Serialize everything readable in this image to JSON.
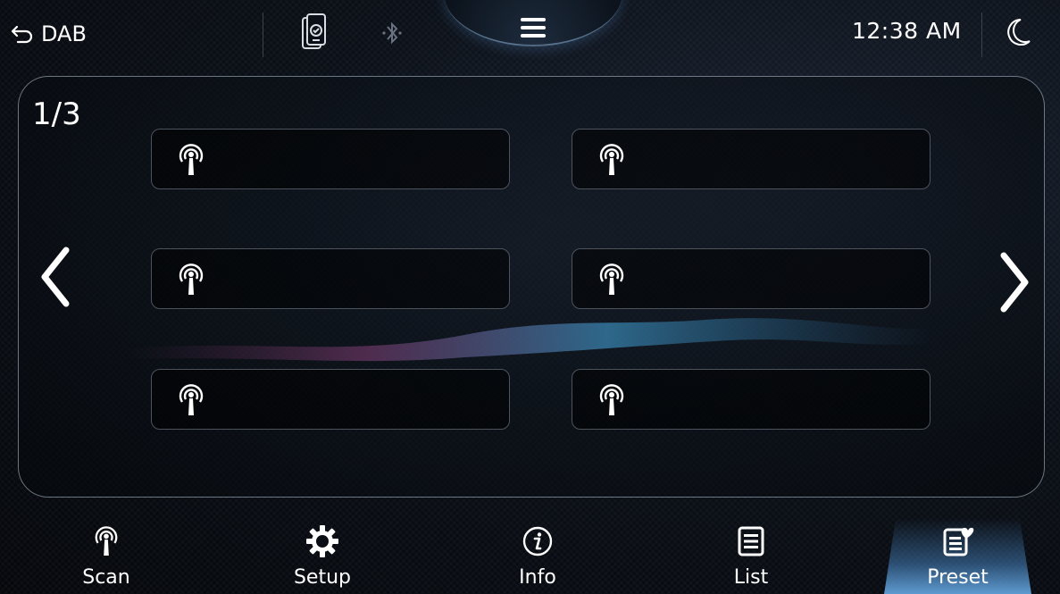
{
  "header": {
    "back_label": "DAB",
    "time": "12:38 AM"
  },
  "icons": {
    "back": "back-arrow-icon",
    "phone": "phone-connect-icon",
    "bluetooth": "bluetooth-icon",
    "menu": "hamburger-menu-icon",
    "night_mode": "moon-icon",
    "station": "antenna-icon"
  },
  "presets": {
    "page": "1/3",
    "slots": [
      {
        "name": ""
      },
      {
        "name": ""
      },
      {
        "name": ""
      },
      {
        "name": ""
      },
      {
        "name": ""
      },
      {
        "name": ""
      }
    ]
  },
  "bottom_nav": {
    "active": "Preset",
    "tabs": [
      {
        "label": "Scan",
        "icon": "antenna-icon"
      },
      {
        "label": "Setup",
        "icon": "gear-icon"
      },
      {
        "label": "Info",
        "icon": "info-icon"
      },
      {
        "label": "List",
        "icon": "list-icon"
      },
      {
        "label": "Preset",
        "icon": "preset-heart-icon"
      }
    ]
  },
  "colors": {
    "accent": "#5d9ad0",
    "text": "#ffffff",
    "slot_border": "#4c535d"
  }
}
